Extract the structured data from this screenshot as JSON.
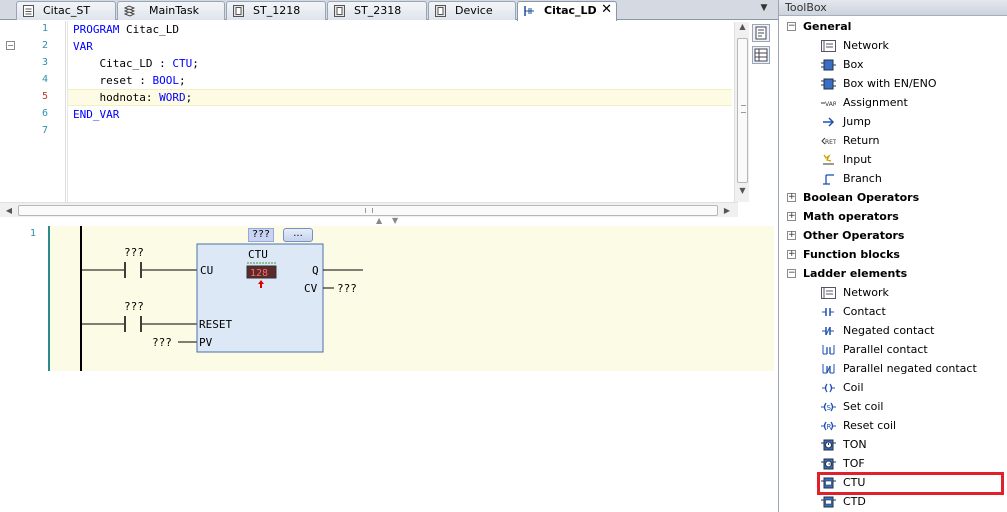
{
  "tabs": [
    {
      "label": "Citac_ST",
      "icon": "document-icon",
      "active": false
    },
    {
      "label": "MainTask",
      "icon": "task-icon",
      "active": false
    },
    {
      "label": "ST_1218",
      "icon": "pou-icon",
      "active": false
    },
    {
      "label": "ST_2318",
      "icon": "pou-icon",
      "active": false
    },
    {
      "label": "Device",
      "icon": "device-icon",
      "active": false
    },
    {
      "label": "Citac_LD",
      "icon": "ladder-icon",
      "active": true,
      "close": "✕"
    }
  ],
  "declaration": {
    "line_numbers": [
      "1",
      "2",
      "3",
      "4",
      "5",
      "6",
      "7"
    ],
    "current_line": "5",
    "lines": {
      "l1_kw": "PROGRAM",
      "l1_name": " Citac_LD",
      "l2_kw": "VAR",
      "l3_name": "    Citac_LD : ",
      "l3_type": "CTU",
      "l3_end": ";",
      "l4_name": "    reset : ",
      "l4_type": "BOOL",
      "l4_end": ";",
      "l5_name": "    hodnota: ",
      "l5_type": "WORD",
      "l5_end": ";",
      "l6_kw": "END_VAR"
    },
    "fold_symbol": "−"
  },
  "ladder": {
    "network_number": "1",
    "block_instance": "???",
    "ellipsis": "...",
    "block_type": "CTU",
    "contact1_var": "???",
    "contact2_var": "???",
    "input_cu": "CU",
    "input_reset": "RESET",
    "input_pv": "PV",
    "output_q": "Q",
    "output_cv": "CV",
    "pv_value": "???",
    "cv_value": "???"
  },
  "toolbox": {
    "title": "ToolBox",
    "categories": [
      {
        "label": "General",
        "expanded": true,
        "symbol": "−",
        "items": [
          {
            "label": "Network",
            "icon": "network-icon"
          },
          {
            "label": "Box",
            "icon": "box-icon"
          },
          {
            "label": "Box with EN/ENO",
            "icon": "box-en-eno-icon"
          },
          {
            "label": "Assignment",
            "icon": "assignment-icon"
          },
          {
            "label": "Jump",
            "icon": "jump-icon"
          },
          {
            "label": "Return",
            "icon": "return-icon"
          },
          {
            "label": "Input",
            "icon": "input-icon"
          },
          {
            "label": "Branch",
            "icon": "branch-icon"
          }
        ]
      },
      {
        "label": "Boolean Operators",
        "expanded": false,
        "symbol": "+"
      },
      {
        "label": "Math operators",
        "expanded": false,
        "symbol": "+"
      },
      {
        "label": "Other Operators",
        "expanded": false,
        "symbol": "+"
      },
      {
        "label": "Function blocks",
        "expanded": false,
        "symbol": "+"
      },
      {
        "label": "Ladder elements",
        "expanded": true,
        "symbol": "−",
        "items": [
          {
            "label": "Network",
            "icon": "network-icon"
          },
          {
            "label": "Contact",
            "icon": "contact-icon"
          },
          {
            "label": "Negated contact",
            "icon": "negated-contact-icon"
          },
          {
            "label": "Parallel contact",
            "icon": "parallel-contact-icon"
          },
          {
            "label": "Parallel negated contact",
            "icon": "parallel-negated-contact-icon"
          },
          {
            "label": "Coil",
            "icon": "coil-icon"
          },
          {
            "label": "Set coil",
            "icon": "set-coil-icon"
          },
          {
            "label": "Reset coil",
            "icon": "reset-coil-icon"
          },
          {
            "label": "TON",
            "icon": "ton-icon"
          },
          {
            "label": "TOF",
            "icon": "tof-icon"
          },
          {
            "label": "CTU",
            "icon": "ctu-icon",
            "highlighted": true
          },
          {
            "label": "CTD",
            "icon": "ctd-icon"
          }
        ]
      }
    ]
  },
  "colors": {
    "highlight": "#e0202a",
    "keyword": "#0000ff",
    "line_number": "#2b91af",
    "network_bg": "#fcfbe6"
  }
}
